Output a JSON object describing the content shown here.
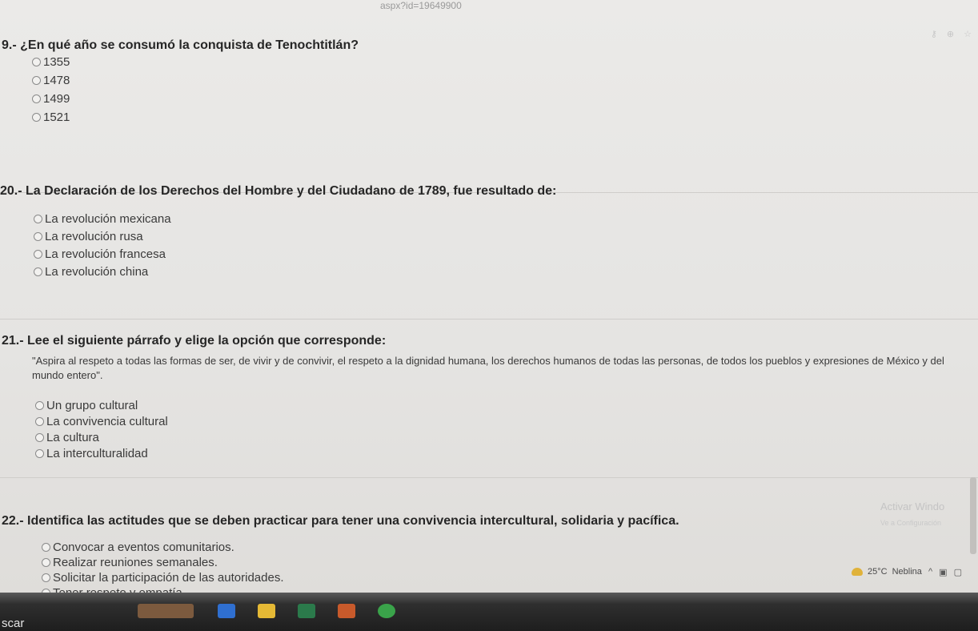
{
  "browser": {
    "url_fragment": "aspx?id=19649900"
  },
  "questions": [
    {
      "number": "9.-",
      "text": "¿En qué año se consumó la conquista de Tenochtitlán?",
      "options": [
        "1355",
        "1478",
        "1499",
        "1521"
      ]
    },
    {
      "number": "20.-",
      "text": "La Declaración de los Derechos del Hombre y del Ciudadano de 1789, fue resultado de:",
      "options": [
        "La revolución mexicana",
        "La revolución rusa",
        "La revolución francesa",
        "La revolución china"
      ]
    },
    {
      "number": "21.-",
      "text": "Lee el siguiente párrafo y elige la opción que corresponde:",
      "quote": "\"Aspira al respeto a todas las formas de ser, de vivir y de convivir, el respeto a la dignidad humana, los derechos humanos de todas las personas, de todos los pueblos y expresiones de México y del mundo entero\".",
      "options": [
        "Un grupo cultural",
        "La convivencia cultural",
        "La cultura",
        "La interculturalidad"
      ]
    },
    {
      "number": "22.-",
      "text": "Identifica las actitudes que se deben practicar para tener una convivencia intercultural, solidaria y pacífica.",
      "options": [
        "Convocar a eventos comunitarios.",
        "Realizar reuniones semanales.",
        "Solicitar la participación de las autoridades.",
        "Tener respeto y empatía."
      ]
    }
  ],
  "watermark": {
    "title": "Activar Windo",
    "subtitle": "Ve a Configuración"
  },
  "weather": {
    "temp": "25°C",
    "condition": "Neblina"
  },
  "taskbar": {
    "search_text": "scar"
  },
  "colors": {
    "background": "#e6e5e3",
    "text": "#2e2e2e",
    "taskbar": "#1e1e1e"
  }
}
